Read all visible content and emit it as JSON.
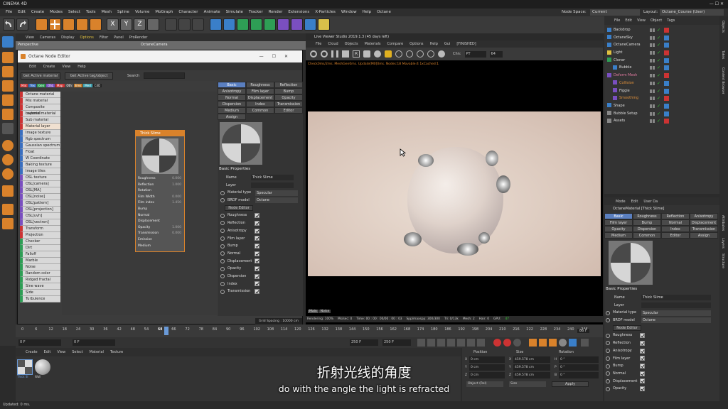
{
  "app": {
    "title": "CINEMA 4D"
  },
  "menu": [
    "File",
    "Edit",
    "Create",
    "Modes",
    "Select",
    "Tools",
    "Mesh",
    "Spline",
    "Volume",
    "MoGraph",
    "Character",
    "Animate",
    "Simulate",
    "Tracker",
    "Render",
    "Extensions",
    "X-Particles",
    "Window",
    "Help",
    "Octane"
  ],
  "node_space": {
    "label": "Node Space:",
    "value": "Current (Standard/Physical)"
  },
  "layout": {
    "label": "Layout:",
    "value": "Octane_Course (User)"
  },
  "viewport_menu": [
    "View",
    "Cameras",
    "Display",
    "Options",
    "Filter",
    "Panel",
    "ProRender"
  ],
  "viewport": {
    "label": "Perspective",
    "camera": "OctaneCamera"
  },
  "node_editor": {
    "title": "Octane Node Editor",
    "menu": [
      "Edit",
      "Create",
      "View",
      "Help"
    ],
    "get_active_material": "Get Active material",
    "get_active_tag": "Get Active tag/object",
    "search_label": "Search",
    "categories": [
      "Mat",
      "Tex",
      "Gen",
      "OSL",
      "Map",
      "Oth",
      "Ems",
      "Med",
      "C4D"
    ],
    "nodes": [
      "Octane material",
      "Mix material",
      "Composite material",
      "Layered material",
      "Sub material",
      "Material layer",
      "Image texture",
      "Rgb spectrum",
      "Gaussian spectrum",
      "Float",
      "W Coordinate",
      "Baking texture",
      "Image tiles",
      "OSL texture",
      "OSL[camera]",
      "OSL[MA]",
      "OSL[noise]",
      "OSL[pattern]",
      "OSL[projection]",
      "OSL[uvh]",
      "OSL[vectron]",
      "Transform",
      "Projection",
      "Checker",
      "Dirt",
      "Falloff",
      "Marble",
      "Noise",
      "Random color",
      "Ridged fractal",
      "Sine wave",
      "Side",
      "Turbulence"
    ],
    "node_card": {
      "title": "Thick Slime",
      "rows": [
        {
          "label": "Roughness",
          "value": "0.000"
        },
        {
          "label": "Reflection",
          "value": "1.000"
        },
        {
          "label": "Rotation",
          "value": ""
        },
        {
          "label": "Film Width",
          "value": "0.000"
        },
        {
          "label": "Film index",
          "value": "1.450"
        },
        {
          "label": "Bump",
          "value": ""
        },
        {
          "label": "Normal",
          "value": ""
        },
        {
          "label": "Displacement",
          "value": ""
        },
        {
          "label": "Opacity",
          "value": "1.000"
        },
        {
          "label": "Transmission",
          "value": "0.000"
        },
        {
          "label": "Emission",
          "value": ""
        },
        {
          "label": "Medium",
          "value": ""
        }
      ]
    },
    "grid_spacing": "Grid Spacing : 10000 cm",
    "tabs": [
      "Basic",
      "Roughness",
      "Reflection",
      "Anisotropy",
      "Film layer",
      "Bump",
      "Normal",
      "Displacement",
      "Opacity",
      "Dispersion",
      "Index",
      "Transmission",
      "Medium",
      "Common",
      "Editor",
      "Assign"
    ],
    "basic_properties": "Basic Properties",
    "name_label": "Name",
    "name_value": "Thick Slime",
    "layer_label": "Layer",
    "material_type_label": "Material type",
    "material_type_value": "Specular",
    "brdf_label": "BRDF model",
    "brdf_value": "Octane",
    "node_editor_btn": "Node Editor",
    "checks": [
      "Roughness",
      "Reflection",
      "Anisotropy",
      "Film layer",
      "Bump",
      "Normal",
      "Displacement",
      "Opacity",
      "Dispersion",
      "Index",
      "Transmission"
    ]
  },
  "live_viewer": {
    "title": "Live Viewer Studio 2019.1.3 (45 days left)",
    "menu": [
      "File",
      "Cloud",
      "Objects",
      "Materials",
      "Compare",
      "Options",
      "Help",
      "Gui",
      "[FINISHED]"
    ],
    "chn_label": "Chn:",
    "chn_value": "PT",
    "chn_num": "64",
    "status": "Check0ms/2ms. MeshGen0ms. Update[M0]0ms. Nodes:18 Movable:4 1xCached:1",
    "tabs": [
      "Main",
      "Noise"
    ],
    "render_stats": {
      "rendering": "Rendering: 100%",
      "ms": "Ms/sec: 0",
      "time": "Time: 00 : 00 : 00/00 : 00 : 03",
      "spp": "Spp/maxspp: 300/300",
      "tri": "Tri: 0/13k",
      "mesh": "Mesh: 2",
      "hair": "Hair: 0",
      "gpu_label": "GPU:",
      "gpu": "47"
    }
  },
  "objects": {
    "menu": [
      "File",
      "Edit",
      "View",
      "Object",
      "Tags"
    ],
    "items": [
      {
        "name": "Backdrop",
        "indent": 0,
        "color": "#ddd"
      },
      {
        "name": "OctaneSky",
        "indent": 0,
        "color": "#ddd"
      },
      {
        "name": "OctaneCamera",
        "indent": 0,
        "color": "#ddd"
      },
      {
        "name": "Light",
        "indent": 0,
        "color": "#ddd"
      },
      {
        "name": "Cloner",
        "indent": 0,
        "color": "#ddd"
      },
      {
        "name": "Bubble",
        "indent": 1,
        "color": "#ddd"
      },
      {
        "name": "Deform Mesh",
        "indent": 0,
        "color": "#e07aa0"
      },
      {
        "name": "Collision",
        "indent": 1,
        "color": "#e0903a"
      },
      {
        "name": "Figgie",
        "indent": 1,
        "color": "#ddd"
      },
      {
        "name": "Smoothing",
        "indent": 1,
        "color": "#e0903a"
      },
      {
        "name": "Shape",
        "indent": 0,
        "color": "#ddd"
      },
      {
        "name": "Bubble Setup",
        "indent": 0,
        "color": "#ddd"
      },
      {
        "name": "Assets",
        "indent": 0,
        "color": "#ddd"
      }
    ]
  },
  "right_tabs": [
    "Objects",
    "Takes",
    "Content Browser",
    "Attributes",
    "Layers",
    "Structure"
  ],
  "attributes": {
    "menu": [
      "Mode",
      "Edit",
      "User Da"
    ],
    "title": "OctaneMaterial [Thick Slime]",
    "tabs": [
      "Basic",
      "Roughness",
      "Reflection",
      "Anisotropy",
      "Film layer",
      "Bump",
      "Normal",
      "Displacement",
      "Opacity",
      "Dispersion",
      "Index",
      "Transmission",
      "Medium",
      "Common",
      "Editor",
      "Assign"
    ],
    "basic_properties": "Basic Properties",
    "name_label": "Name",
    "name_value": "Thick Slime",
    "layer_label": "Layer",
    "material_type_label": "Material type",
    "material_type_value": "Specular",
    "brdf_label": "BRDF model",
    "brdf_value": "Octane",
    "node_editor_btn": "Node Editor",
    "checks": [
      "Roughness",
      "Reflection",
      "Anisotropy",
      "Film layer",
      "Bump",
      "Normal",
      "Displacement",
      "Opacity"
    ]
  },
  "timeline": {
    "ticks": [
      "0",
      "6",
      "12",
      "18",
      "24",
      "30",
      "36",
      "42",
      "48",
      "54",
      "60",
      "66",
      "72",
      "78",
      "84",
      "90",
      "96",
      "102",
      "108",
      "114",
      "120",
      "126",
      "132",
      "138",
      "144",
      "150",
      "156",
      "162",
      "168",
      "174",
      "180",
      "186",
      "192",
      "198",
      "204",
      "210",
      "216",
      "222",
      "228",
      "234",
      "240",
      "246"
    ],
    "current": "64",
    "end_label": "86 F",
    "start_field": "0 F",
    "current_field": "0 F",
    "end_field": "250 F",
    "end_field2": "250 F"
  },
  "materials": {
    "menu": [
      "Create",
      "Edit",
      "View",
      "Select",
      "Material",
      "Texture"
    ],
    "items": [
      "Thick Sl",
      "Wall"
    ]
  },
  "coords": {
    "headers": [
      "Position",
      "Size",
      "Rotation"
    ],
    "rows": [
      {
        "axis": "X",
        "pos": "0 cm",
        "size": "459.578 cm",
        "rot_label": "H",
        "rot": "0 °"
      },
      {
        "axis": "Y",
        "pos": "0 cm",
        "size": "459.578 cm",
        "rot_label": "P",
        "rot": "0 °"
      },
      {
        "axis": "Z",
        "pos": "0 cm",
        "size": "459.578 cm",
        "rot_label": "B",
        "rot": "0 °"
      }
    ],
    "mode": "Object (Rel)",
    "size_mode": "Size",
    "apply": "Apply"
  },
  "status_bar": "Updated: 0 ms.",
  "subtitles": {
    "zh": "折射光线的角度",
    "en": "do with the angle the light is refracted"
  }
}
